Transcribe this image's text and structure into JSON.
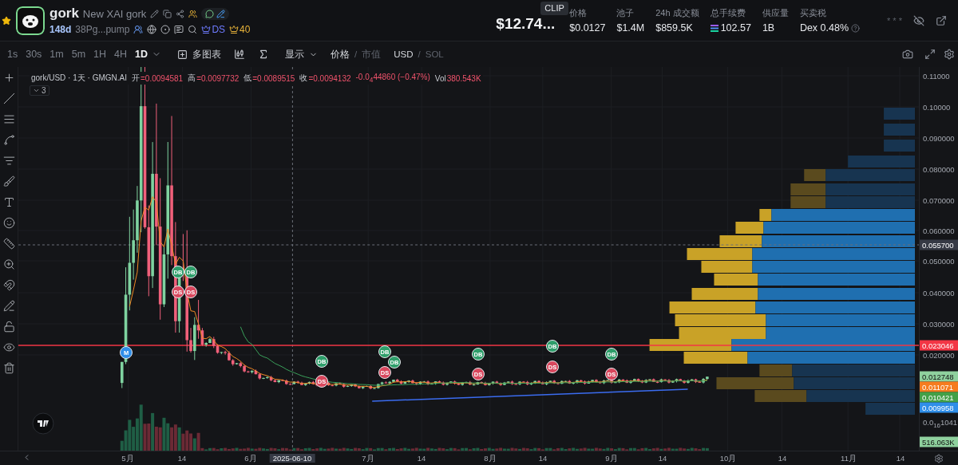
{
  "token": {
    "symbol": "gork",
    "name": "New XAI gork",
    "age": "148d",
    "address": "38Pg...pump",
    "ds_label": "DS",
    "badge_count": "40"
  },
  "headline": {
    "value": "$12.74...",
    "tooltip": "CLIP"
  },
  "stats": [
    {
      "label": "价格",
      "value": "$0.0127",
      "kind": "plain"
    },
    {
      "label": "池子",
      "value": "$1.4M",
      "kind": "plain"
    },
    {
      "label": "24h 成交额",
      "value": "$859.5K",
      "kind": "plain"
    },
    {
      "label": "总手续费",
      "value": "102.57",
      "kind": "sol"
    },
    {
      "label": "供应量",
      "value": "1B",
      "kind": "plain"
    },
    {
      "label": "买卖税",
      "value": "Dex 0.48%",
      "kind": "tax"
    }
  ],
  "masked": "* * *",
  "intervals": [
    {
      "label": "1s",
      "selected": false
    },
    {
      "label": "30s",
      "selected": false
    },
    {
      "label": "1m",
      "selected": false
    },
    {
      "label": "5m",
      "selected": false
    },
    {
      "label": "1H",
      "selected": false
    },
    {
      "label": "4H",
      "selected": false
    },
    {
      "label": "1D",
      "selected": true
    }
  ],
  "toolbar": {
    "multi_chart": "多图表",
    "display": "显示",
    "separator": "/",
    "price_mode": [
      {
        "label": "价格",
        "selected": true
      },
      {
        "label": "市值",
        "selected": false
      }
    ],
    "currency": [
      {
        "label": "USD",
        "selected": true
      },
      {
        "label": "SOL",
        "selected": false
      }
    ]
  },
  "legend": {
    "title": "gork/USD · 1天 · GMGN.AI",
    "fields": [
      {
        "label": "开",
        "value": "=0.0094581"
      },
      {
        "label": "高",
        "value": "=0.0097732"
      },
      {
        "label": "低",
        "value": "=0.0089515"
      },
      {
        "label": "收",
        "value": "=0.0094132"
      }
    ],
    "change": "-0.0$_{4}$44860 (−0.47%)",
    "volume_label": "Vol",
    "volume_value": "380.543K",
    "indicators": "3"
  },
  "markers": [
    {
      "label": "M",
      "kind": "mint"
    },
    {
      "label": "DB",
      "kind": "buy"
    },
    {
      "label": "DB",
      "kind": "buy"
    },
    {
      "label": "DS",
      "kind": "sell"
    },
    {
      "label": "DS",
      "kind": "sell"
    },
    {
      "label": "DB",
      "kind": "buy"
    },
    {
      "label": "DS",
      "kind": "sell"
    },
    {
      "label": "DB",
      "kind": "buy"
    },
    {
      "label": "DS",
      "kind": "sell"
    },
    {
      "label": "DB",
      "kind": "buy"
    },
    {
      "label": "DB",
      "kind": "buy"
    },
    {
      "label": "DS",
      "kind": "sell"
    },
    {
      "label": "DB",
      "kind": "buy"
    },
    {
      "label": "DS",
      "kind": "sell"
    },
    {
      "label": "DB",
      "kind": "buy"
    },
    {
      "label": "DS",
      "kind": "sell"
    }
  ],
  "price_axis": [
    "0.11000",
    "0.10000",
    "0.090000",
    "0.080000",
    "0.070000",
    "0.060000",
    "0.050000",
    "0.040000",
    "0.030000",
    "0.020000",
    "0.0$_{16}$1041"
  ],
  "price_badges": [
    {
      "value": "0.055700",
      "color": "#363a45"
    },
    {
      "value": "0.023046",
      "color": "#f23645"
    },
    {
      "value": "0.012748",
      "color": "#8fd19e"
    },
    {
      "value": "0.011071",
      "color": "#f57c1f"
    },
    {
      "value": "0.010421",
      "color": "#43a047"
    },
    {
      "value": "0.009958",
      "color": "#2f8ee8"
    },
    {
      "value": "516.063K",
      "color": "#8fd19e"
    }
  ],
  "time_axis": [
    {
      "label": "5月",
      "selected": false
    },
    {
      "label": "14",
      "selected": false
    },
    {
      "label": "6月",
      "selected": false
    },
    {
      "label": "2025-06-10",
      "selected": true
    },
    {
      "label": "7月",
      "selected": false
    },
    {
      "label": "14",
      "selected": false
    },
    {
      "label": "8月",
      "selected": false
    },
    {
      "label": "14",
      "selected": false
    },
    {
      "label": "9月",
      "selected": false
    },
    {
      "label": "14",
      "selected": false
    },
    {
      "label": "10月",
      "selected": false
    },
    {
      "label": "14",
      "selected": false
    },
    {
      "label": "11月",
      "selected": false
    },
    {
      "label": "14",
      "selected": false
    }
  ]
}
